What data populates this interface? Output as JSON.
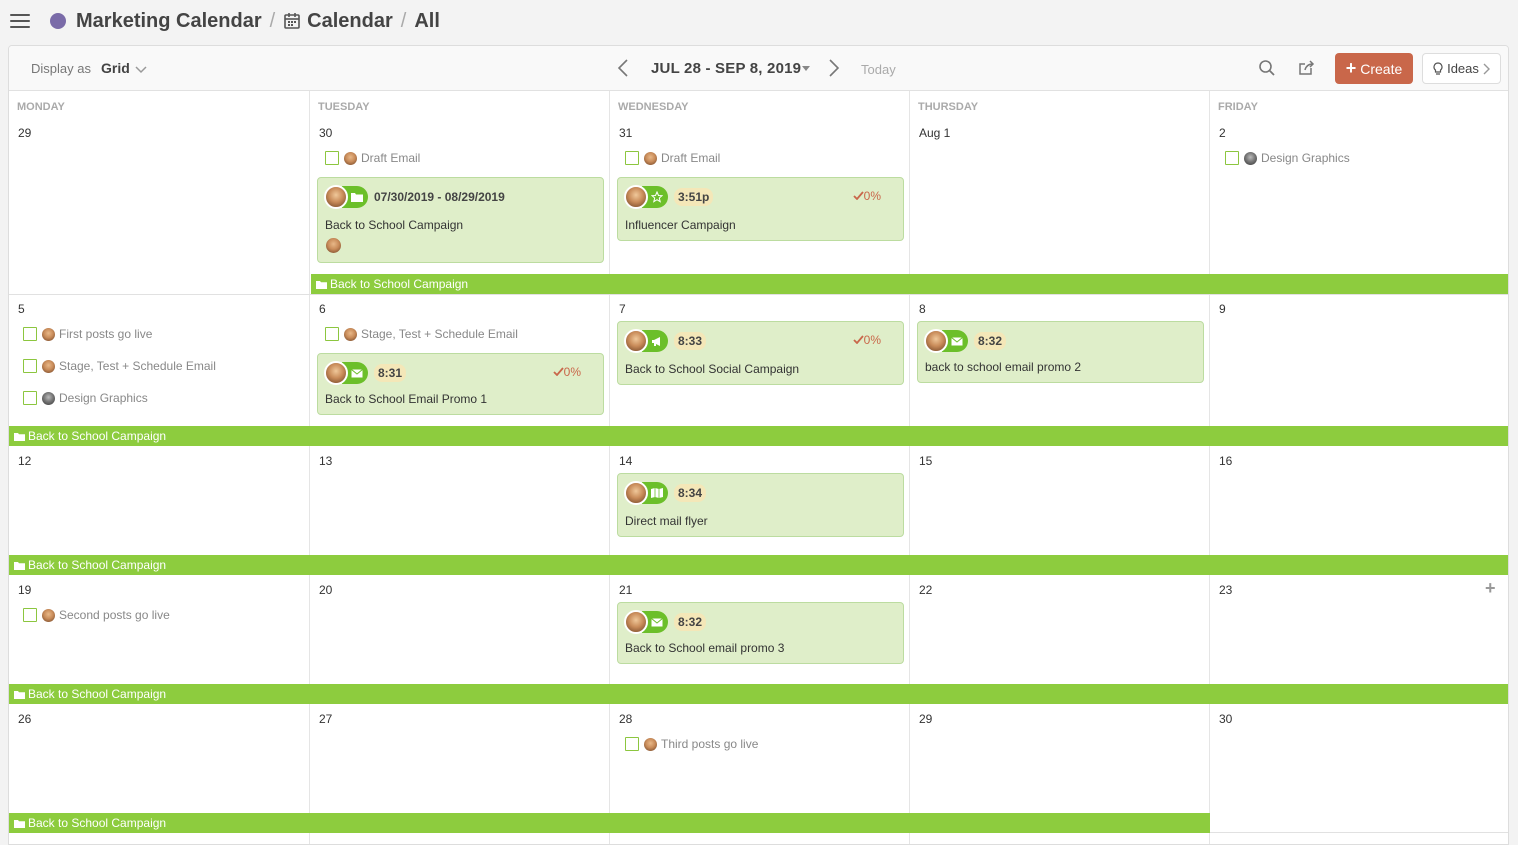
{
  "breadcrumb": {
    "workspace": "Marketing Calendar",
    "calendar": "Calendar",
    "view": "All",
    "workspace_color": "#7a6ba8"
  },
  "toolbar": {
    "display_as_label": "Display as",
    "display_value": "Grid",
    "date_range": "JUL 28 - SEP 8, 2019",
    "today_label": "Today",
    "create_label": "Create",
    "ideas_label": "Ideas"
  },
  "colors": {
    "accent": "#c9674a",
    "campaign_bar": "#8dcc3e",
    "card_bg": "#dfeec9",
    "pill_green": "#6cbf2a"
  },
  "day_headers": [
    "MONDAY",
    "TUESDAY",
    "WEDNESDAY",
    "THURSDAY",
    "FRIDAY"
  ],
  "weeks": [
    {
      "dates": [
        "29",
        "30",
        "31",
        "Aug 1",
        "2"
      ],
      "tasks": [
        {
          "label": "Draft Email",
          "avatar": "female-avatar"
        },
        {
          "label": "Draft Email",
          "avatar": "female-avatar"
        },
        {
          "label": "Design Graphics",
          "avatar": "male-avatar"
        }
      ],
      "cards": [
        {
          "pill": "07/30/2019 - 08/29/2019",
          "icon": "folder-icon",
          "title": "Back to School Campaign"
        },
        {
          "pill": "3:51p",
          "icon": "star-icon",
          "pct": "0%",
          "title": "Influencer Campaign"
        }
      ],
      "bar": "Back to School Campaign"
    },
    {
      "dates": [
        "5",
        "6",
        "7",
        "8",
        "9"
      ],
      "tasks": [
        {
          "label": "First posts go live",
          "avatar": "female-avatar"
        },
        {
          "label": "Stage, Test + Schedule Email",
          "avatar": "female-avatar"
        },
        {
          "label": "Design Graphics",
          "avatar": "male-avatar"
        },
        {
          "label": "Stage, Test + Schedule Email",
          "avatar": "female-avatar"
        }
      ],
      "cards": [
        {
          "pill": "8:31",
          "icon": "envelope-icon",
          "pct": "0%",
          "title": "Back to School Email Promo 1"
        },
        {
          "pill": "8:33",
          "icon": "megaphone-icon",
          "pct": "0%",
          "title": "Back to School Social Campaign"
        },
        {
          "pill": "8:32",
          "icon": "envelope-icon",
          "title": "back to school email promo 2"
        }
      ],
      "bar": "Back to School Campaign"
    },
    {
      "dates": [
        "12",
        "13",
        "14",
        "15",
        "16"
      ],
      "cards": [
        {
          "pill": "8:34",
          "icon": "map-icon",
          "title": "Direct mail flyer"
        }
      ],
      "bar": "Back to School Campaign"
    },
    {
      "dates": [
        "19",
        "20",
        "21",
        "22",
        "23"
      ],
      "tasks": [
        {
          "label": "Second posts go live",
          "avatar": "female-avatar"
        }
      ],
      "cards": [
        {
          "pill": "8:32",
          "icon": "envelope-icon",
          "title": "Back to School email promo 3"
        }
      ],
      "bar": "Back to School Campaign"
    },
    {
      "dates": [
        "26",
        "27",
        "28",
        "29",
        "30"
      ],
      "tasks": [
        {
          "label": "Third posts go live",
          "avatar": "female-avatar"
        }
      ],
      "bar": "Back to School Campaign"
    }
  ]
}
